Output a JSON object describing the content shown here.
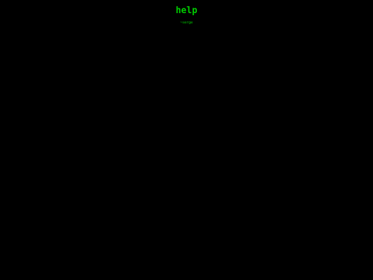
{
  "page": {
    "heading": "help",
    "signature": "~serge",
    "intro": "",
    "body_text": ""
  },
  "colors": {
    "background": "#000000",
    "text": "#00cc00"
  }
}
